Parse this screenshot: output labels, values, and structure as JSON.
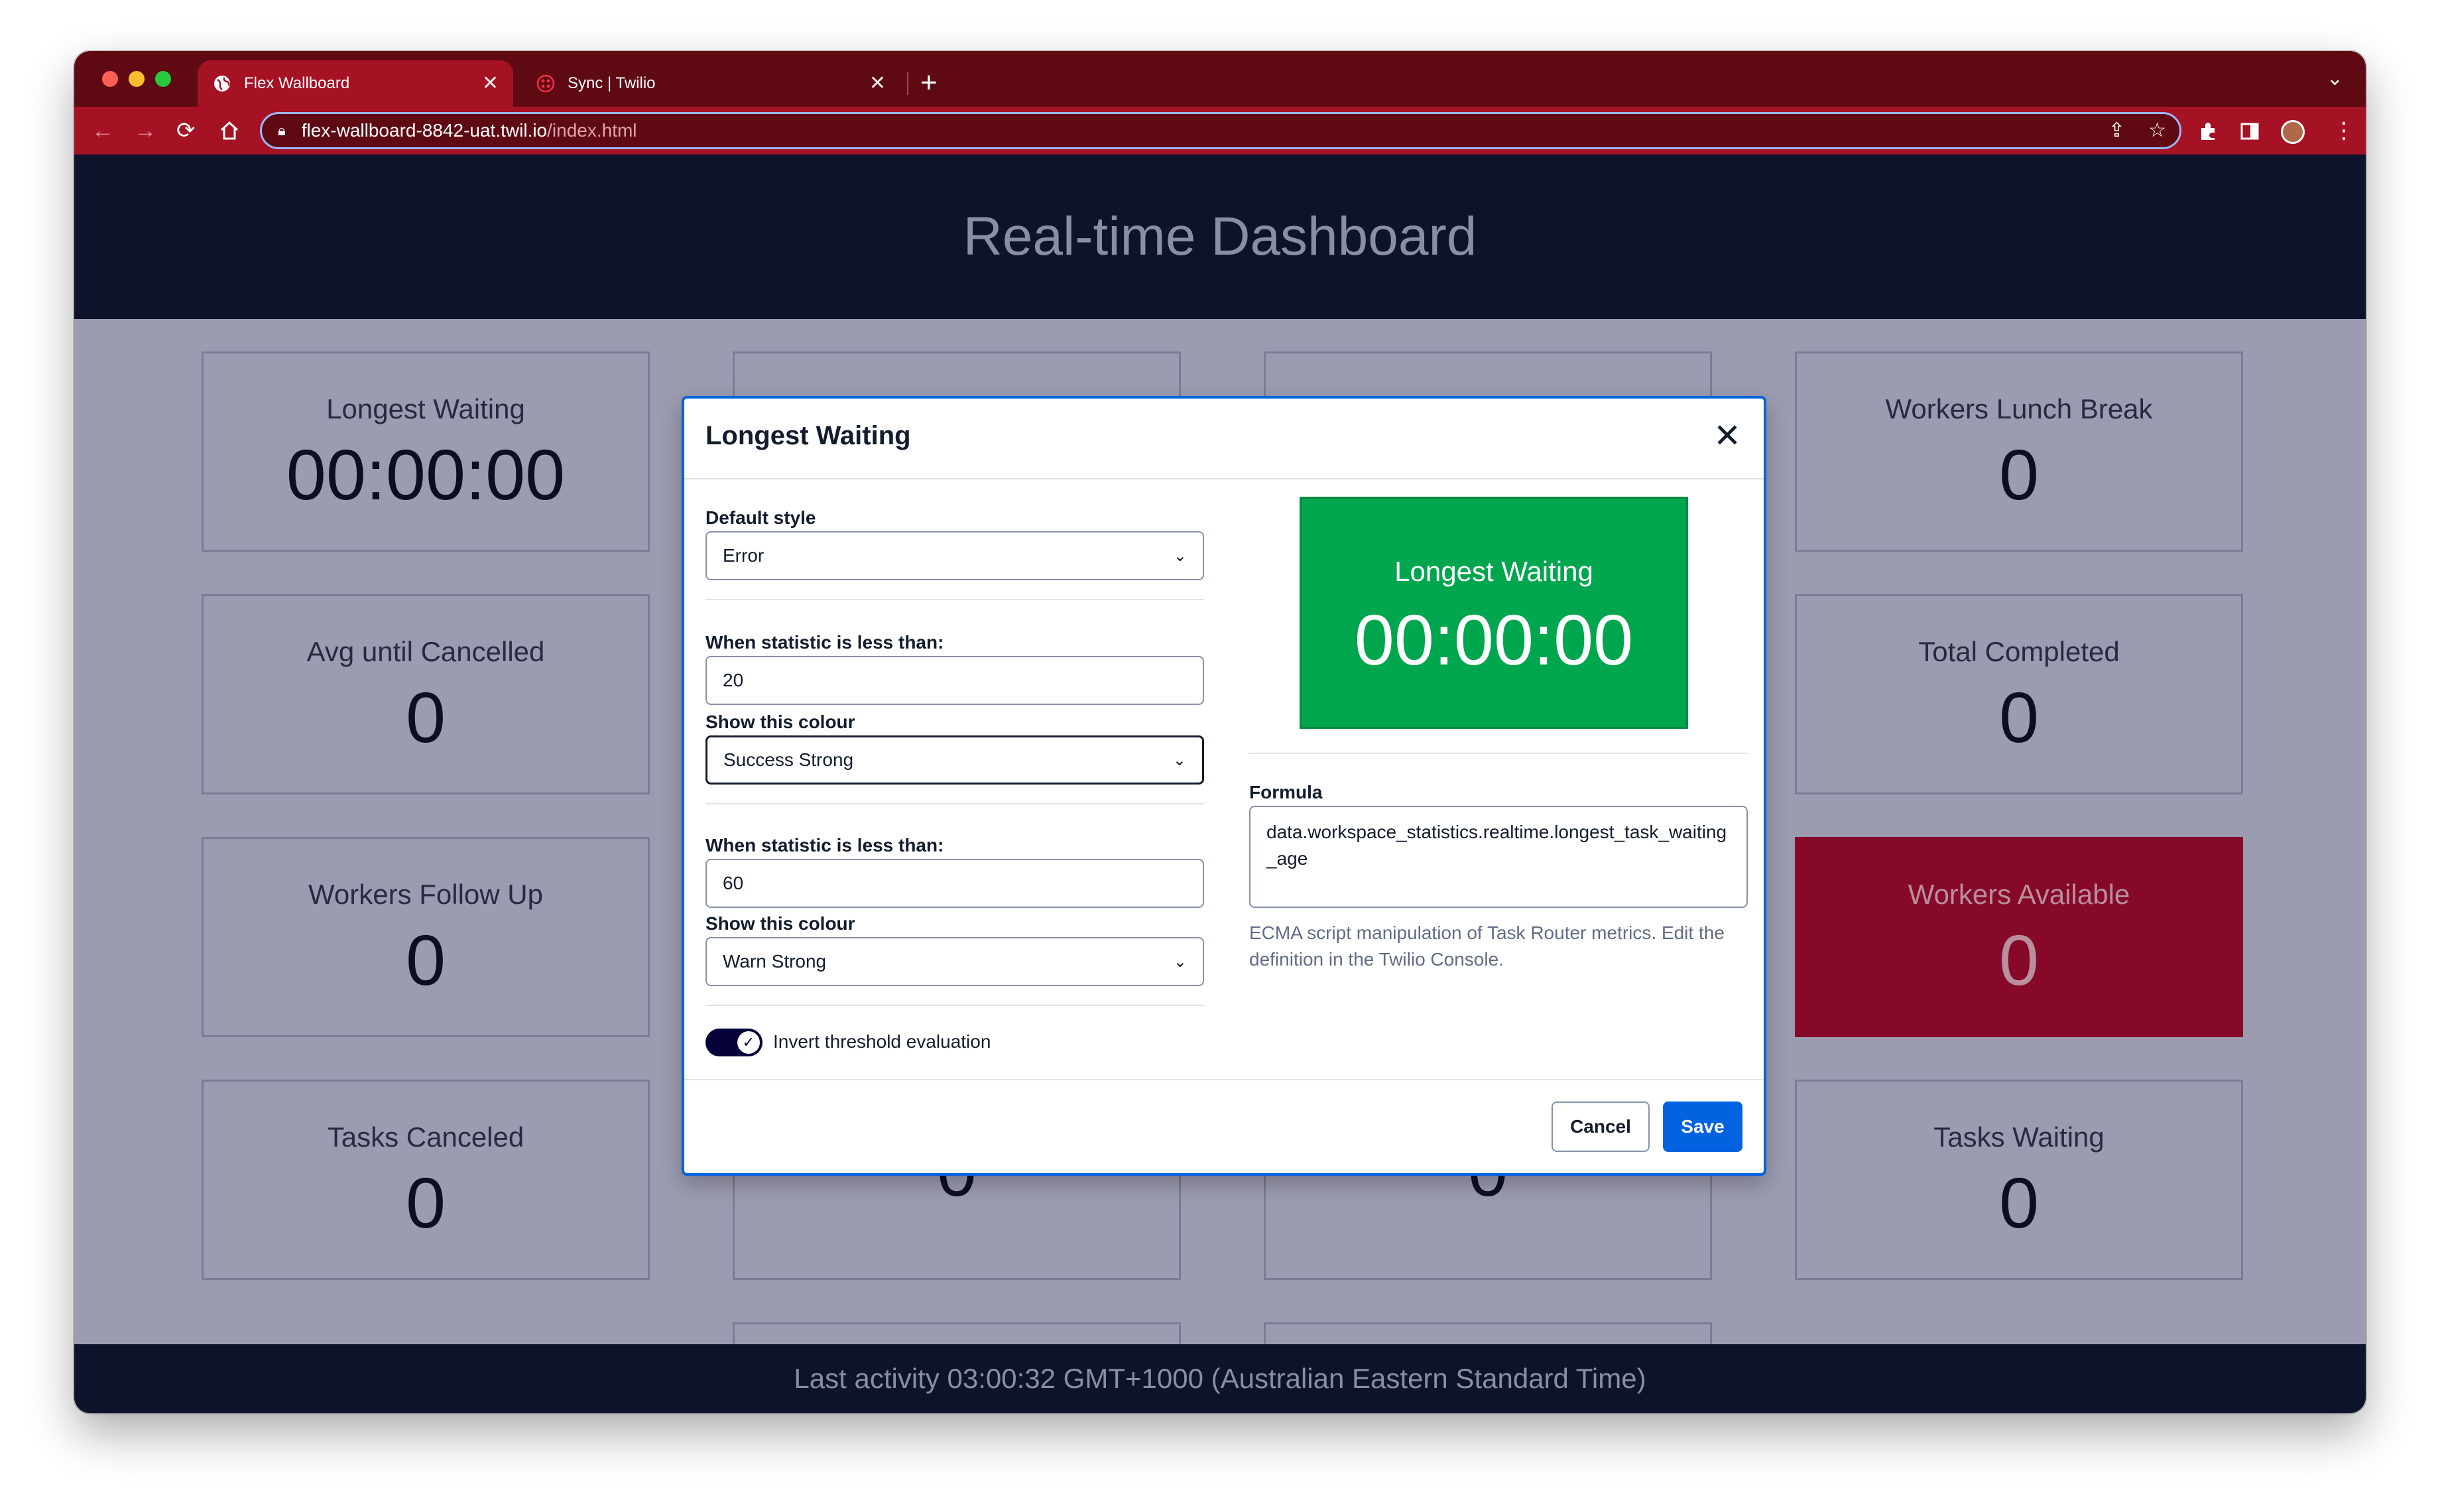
{
  "browser": {
    "tabs": [
      {
        "title": "Flex Wallboard",
        "active": true
      },
      {
        "title": "Sync | Twilio",
        "active": false
      }
    ],
    "new_tab": "+",
    "tab_close": "✕",
    "url_host": "flex-wallboard-8842-uat.twil.io",
    "url_path": "/index.html"
  },
  "dashboard": {
    "title": "Real-time Dashboard",
    "tiles": [
      {
        "label": "Longest Waiting",
        "value": "00:00:00"
      },
      {
        "label": "",
        "value": ""
      },
      {
        "label": "",
        "value": ""
      },
      {
        "label": "Workers Lunch Break",
        "value": "0"
      },
      {
        "label": "Avg until Cancelled",
        "value": "0"
      },
      {
        "label": "Total Completed",
        "value": "0"
      },
      {
        "label": "Workers Follow Up",
        "value": "0"
      },
      {
        "label": "Workers Available",
        "value": "0"
      },
      {
        "label": "Tasks Canceled",
        "value": "0"
      },
      {
        "label": "",
        "value": "0"
      },
      {
        "label": "",
        "value": "0"
      },
      {
        "label": "Tasks Waiting",
        "value": "0"
      }
    ],
    "footer": "Last activity 03:00:32 GMT+1000 (Australian Eastern Standard Time)"
  },
  "modal": {
    "title": "Longest Waiting",
    "close": "✕",
    "default_style_label": "Default style",
    "default_style_value": "Error",
    "threshold1_label": "When statistic is less than:",
    "threshold1_value": "20",
    "colour1_label": "Show this colour",
    "colour1_value": "Success Strong",
    "threshold2_label": "When statistic is less than:",
    "threshold2_value": "60",
    "colour2_label": "Show this colour",
    "colour2_value": "Warn Strong",
    "invert_label": "Invert threshold evaluation",
    "invert_enabled": true,
    "preview_label": "Longest Waiting",
    "preview_value": "00:00:00",
    "formula_label": "Formula",
    "formula_value": "data.workspace_statistics.realtime.longest_task_waiting_age",
    "formula_help": "ECMA script manipulation of Task Router metrics. Edit the definition in the Twilio Console.",
    "cancel_label": "Cancel",
    "save_label": "Save"
  },
  "colors": {
    "tabbar": "#5f0a12",
    "toolbar": "#a51224",
    "header": "#0e132c",
    "overlay": "#9b9cb0",
    "error_tile": "#86092a",
    "success_preview": "#00a64e",
    "primary": "#0263e0"
  }
}
